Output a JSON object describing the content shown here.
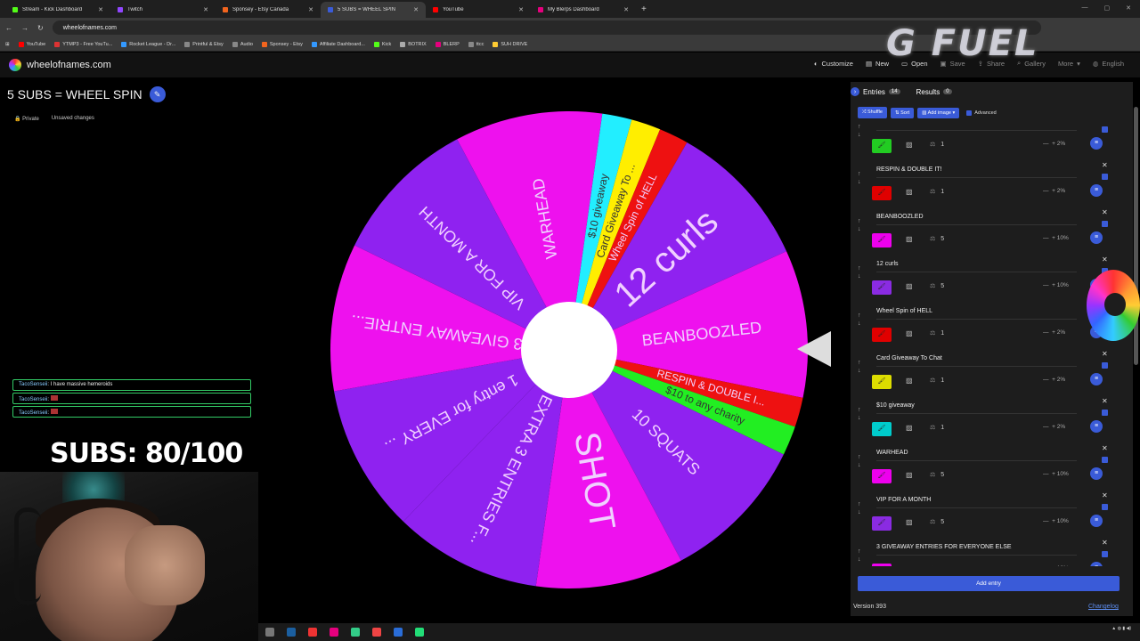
{
  "browser": {
    "tabs": [
      {
        "label": "Stream - Kick Dashboard",
        "color": "#53fc18"
      },
      {
        "label": "Twitch",
        "color": "#9146ff"
      },
      {
        "label": "Sponsey - Etsy Canada",
        "color": "#f1641e"
      },
      {
        "label": "5 SUBS = WHEEL SPIN",
        "color": "#3a5bd8",
        "active": true
      },
      {
        "label": "YouTube",
        "color": "#ff0000"
      },
      {
        "label": "My Blerps Dashboard",
        "color": "#e6007e"
      }
    ],
    "url": "wheelofnames.com",
    "bookmarks": [
      {
        "label": "YouTube",
        "color": "#ff0000"
      },
      {
        "label": "YTMP3 - Free YouTu...",
        "color": "#d33"
      },
      {
        "label": "Rocket League - Dr...",
        "color": "#39f"
      },
      {
        "label": "Printful & Etsy",
        "color": "#888"
      },
      {
        "label": "Audio",
        "color": "#888"
      },
      {
        "label": "Sponsey - Etsy",
        "color": "#f1641e"
      },
      {
        "label": "Affiliate Dashboard...",
        "color": "#39f"
      },
      {
        "label": "Kick",
        "color": "#53fc18"
      },
      {
        "label": "BOTRIX",
        "color": "#aaa"
      },
      {
        "label": "BLERP",
        "color": "#e6007e"
      },
      {
        "label": "ttcc",
        "color": "#888"
      },
      {
        "label": "SUH DRIVE",
        "color": "#fc3"
      }
    ]
  },
  "site": {
    "name": "wheelofnames.com",
    "menu": [
      "Customize",
      "New",
      "Open",
      "Save",
      "Share",
      "Gallery",
      "More",
      "English"
    ]
  },
  "wheel_title": "5 SUBS = WHEEL SPIN",
  "status": {
    "private": "Private",
    "unsaved": "Unsaved changes"
  },
  "chat": [
    {
      "user": "TacoSenseii",
      "msg": ": I have massive hemeroids"
    },
    {
      "user": "TacoSenseii",
      "msg": ": "
    },
    {
      "user": "TacoSenseii",
      "msg": ": "
    }
  ],
  "subs_counter": "SUBS: 80/100",
  "overlay_logo": "G FUEL",
  "panel": {
    "tab_entries": "Entries",
    "entries_count": "14",
    "tab_results": "Results",
    "results_count": "0",
    "shuffle": "Shuffle",
    "sort": "Sort",
    "add_image": "Add image",
    "advanced": "Advanced",
    "add_entry": "Add entry",
    "version": "Version 393",
    "changelog": "Changelog"
  },
  "entries": [
    {
      "name": "",
      "color": "#22cc22",
      "weight": "1",
      "pct": "2%"
    },
    {
      "name": "RESPIN & DOUBLE IT!",
      "color": "#e00000",
      "weight": "1",
      "pct": "2%"
    },
    {
      "name": "BEANBOOZLED",
      "color": "#ee00ee",
      "weight": "5",
      "pct": "10%"
    },
    {
      "name": "12 curls",
      "color": "#8a2be2",
      "weight": "5",
      "pct": "10%"
    },
    {
      "name": "Wheel Spin of HELL",
      "color": "#e00000",
      "weight": "1",
      "pct": "2%"
    },
    {
      "name": "Card Giveaway To Chat",
      "color": "#dddd00",
      "weight": "1",
      "pct": "2%"
    },
    {
      "name": "$10 giveaway",
      "color": "#00cccc",
      "weight": "1",
      "pct": "2%"
    },
    {
      "name": "WARHEAD",
      "color": "#ee00ee",
      "weight": "5",
      "pct": "10%"
    },
    {
      "name": "VIP FOR A MONTH",
      "color": "#8a2be2",
      "weight": "5",
      "pct": "10%"
    },
    {
      "name": "3 GIVEAWAY ENTRIES FOR EVERYONE ELSE",
      "color": "#ee00ee",
      "weight": "5",
      "pct": "10%"
    }
  ],
  "wheel_segments": [
    {
      "label": "WARHEAD",
      "weight": 5,
      "color": "#ee11ee"
    },
    {
      "label": "$10 giveaway",
      "weight": 1,
      "color": "#22eeff"
    },
    {
      "label": "Card Giveaway To ...",
      "weight": 1,
      "color": "#ffee00"
    },
    {
      "label": "Wheel Spin of HELL",
      "weight": 1,
      "color": "#ee1111"
    },
    {
      "label": "12 curls",
      "weight": 5,
      "color": "#8f22f0"
    },
    {
      "label": "BEANBOOZLED",
      "weight": 5,
      "color": "#ee11ee"
    },
    {
      "label": "RESPIN & DOUBLE I...",
      "weight": 1,
      "color": "#ee1111"
    },
    {
      "label": "$10 to any charity",
      "weight": 1,
      "color": "#22ee22"
    },
    {
      "label": "10 SQUATS",
      "weight": 5,
      "color": "#8f22f0"
    },
    {
      "label": "SHOT",
      "weight": 5,
      "color": "#ee11ee"
    },
    {
      "label": "EXTRA 3 ENTRIES F...",
      "weight": 5,
      "color": "#8f22f0"
    },
    {
      "label": "1 entry for EVERY ...",
      "weight": 5,
      "color": "#8f22f0"
    },
    {
      "label": "3 GIVEAWAY ENTRIE...",
      "weight": 5,
      "color": "#ee11ee"
    },
    {
      "label": "VIP FOR A MONTH",
      "weight": 5,
      "color": "#8f22f0"
    }
  ]
}
